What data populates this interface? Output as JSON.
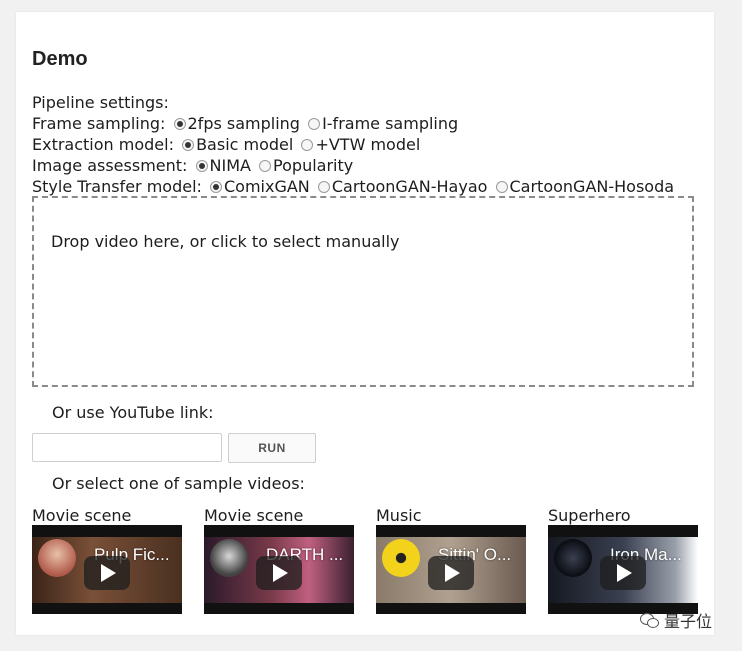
{
  "title": "Demo",
  "settings": {
    "heading": "Pipeline settings:",
    "frame_sampling": {
      "label": "Frame sampling:",
      "options": [
        "2fps sampling",
        "I-frame sampling"
      ],
      "selected": "2fps sampling"
    },
    "extraction_model": {
      "label": "Extraction model:",
      "options": [
        "Basic model",
        "+VTW model"
      ],
      "selected": "Basic model"
    },
    "image_assessment": {
      "label": "Image assessment:",
      "options": [
        "NIMA",
        "Popularity"
      ],
      "selected": "NIMA"
    },
    "style_transfer": {
      "label": "Style Transfer model:",
      "options": [
        "ComixGAN",
        "CartoonGAN-Hayao",
        "CartoonGAN-Hosoda"
      ],
      "selected": "ComixGAN"
    }
  },
  "dropzone": {
    "text": "Drop video here, or click to select manually"
  },
  "youtube": {
    "label": "Or use YouTube link:",
    "input_value": "",
    "run_label": "RUN"
  },
  "samples": {
    "label": "Or select one of sample videos:",
    "videos": [
      {
        "category": "Movie scene",
        "title": "Pulp Fic...",
        "icon": "play-icon",
        "scene_color": "#5a3a2a",
        "avatar_color": "#c8a08a"
      },
      {
        "category": "Movie scene",
        "title": "DARTH ...",
        "icon": "play-icon",
        "scene_color": "#5a2a3a",
        "avatar_color": "#888888"
      },
      {
        "category": "Music",
        "title": "Sittin' O...",
        "icon": "play-icon",
        "scene_color": "#6a5a4a",
        "avatar_color": "#f2d21a"
      },
      {
        "category": "Superhero",
        "title": "Iron Ma...",
        "icon": "play-icon",
        "scene_color": "#2a3040",
        "avatar_color": "#1a2030"
      }
    ]
  },
  "watermark": {
    "text": "量子位"
  }
}
